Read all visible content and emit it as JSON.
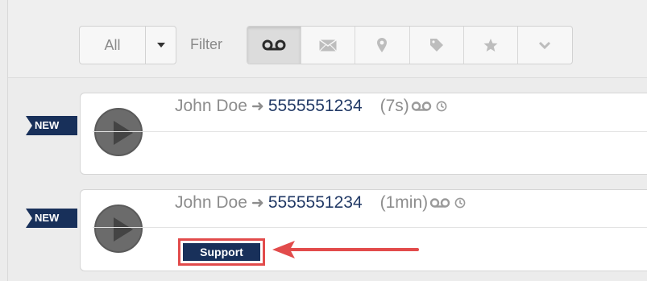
{
  "toolbar": {
    "all_label": "All",
    "filter_label": "Filter",
    "filter_buttons": [
      {
        "icon": "voicemail-icon",
        "active": true
      },
      {
        "icon": "envelope-icon",
        "active": false
      },
      {
        "icon": "map-pin-icon",
        "active": false
      },
      {
        "icon": "tag-icon",
        "active": false
      },
      {
        "icon": "star-icon",
        "active": false
      },
      {
        "icon": "chevron-down-icon",
        "active": false
      }
    ]
  },
  "entries": [
    {
      "badge": "NEW",
      "from": "John Doe",
      "to": "5555551234",
      "duration": "(7s)",
      "tag": null
    },
    {
      "badge": "NEW",
      "from": "John Doe",
      "to": "5555551234",
      "duration": "(1min)",
      "tag": "Support"
    }
  ],
  "colors": {
    "navy": "#18305a",
    "link": "#223a66",
    "muted": "#8d8d8d",
    "highlight": "#e24b4b",
    "background": "#ececec"
  }
}
